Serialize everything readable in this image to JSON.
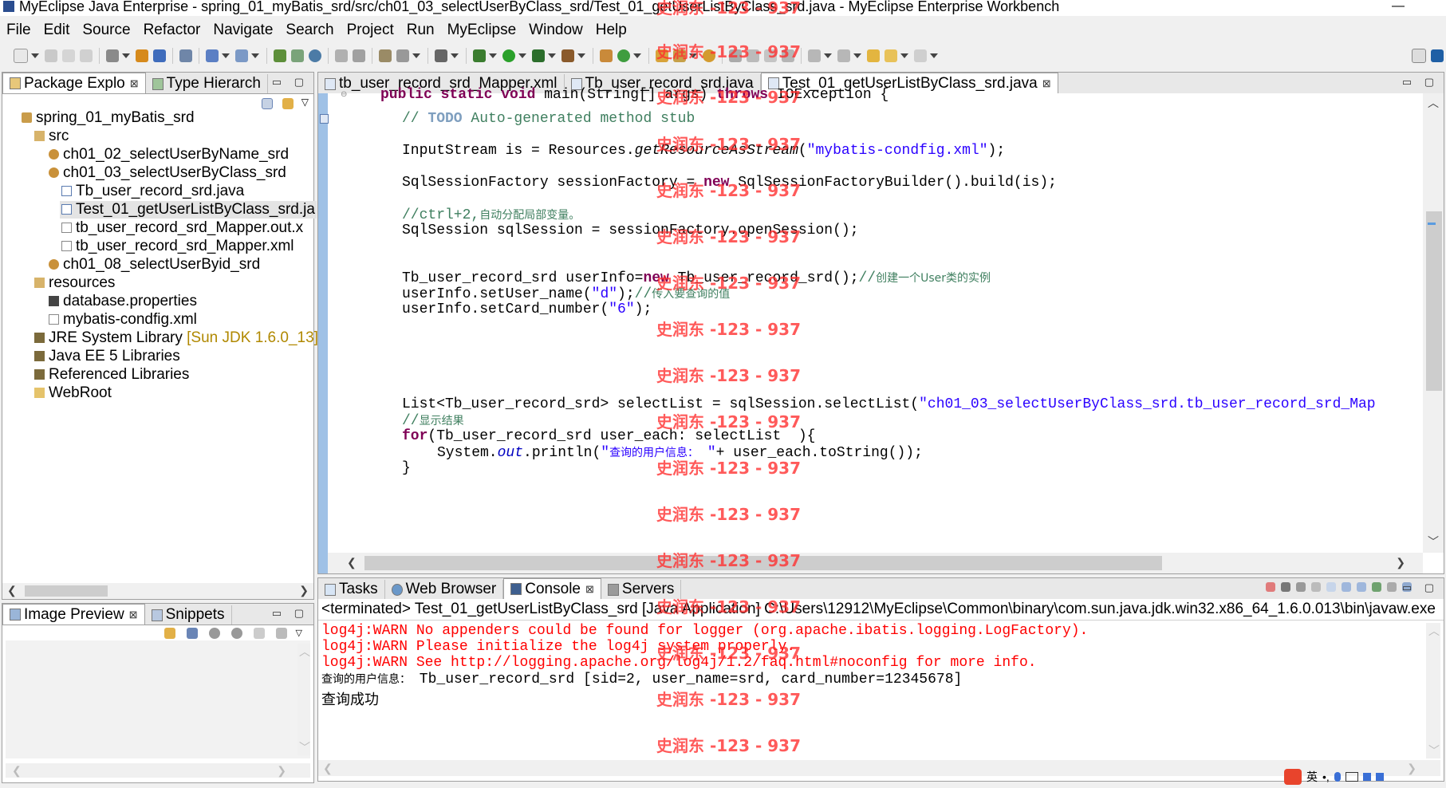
{
  "window": {
    "title": "MyEclipse Java Enterprise - spring_01_myBatis_srd/src/ch01_03_selectUserByClass_srd/Test_01_getUserListByClass_srd.java - MyEclipse Enterprise Workbench",
    "minimize": "—"
  },
  "menu": [
    "File",
    "Edit",
    "Source",
    "Refactor",
    "Navigate",
    "Search",
    "Project",
    "Run",
    "MyEclipse",
    "Window",
    "Help"
  ],
  "package_explorer": {
    "tabs": [
      {
        "label": "Package Explo",
        "close": "⊠"
      },
      {
        "label": "Type Hierarch"
      }
    ],
    "tree": [
      {
        "label": "spring_01_myBatis_srd",
        "icon": "project-icon"
      },
      {
        "label": "src",
        "icon": "source-folder-icon"
      },
      {
        "label": "ch01_02_selectUserByName_srd",
        "icon": "package-icon"
      },
      {
        "label": "ch01_03_selectUserByClass_srd",
        "icon": "package-icon"
      },
      {
        "label": "Tb_user_record_srd.java",
        "icon": "java-file-icon"
      },
      {
        "label": "Test_01_getUserListByClass_srd.ja",
        "icon": "java-file-icon"
      },
      {
        "label": "tb_user_record_srd_Mapper.out.x",
        "icon": "xml-file-icon"
      },
      {
        "label": "tb_user_record_srd_Mapper.xml",
        "icon": "xml-file-icon"
      },
      {
        "label": "ch01_08_selectUserByid_srd",
        "icon": "package-icon"
      },
      {
        "label": "resources",
        "icon": "source-folder-icon"
      },
      {
        "label": "database.properties",
        "icon": "properties-file-icon"
      },
      {
        "label": "mybatis-condfig.xml",
        "icon": "xml-file-icon"
      },
      {
        "label": "JRE System Library",
        "suffix": "[Sun JDK 1.6.0_13]",
        "icon": "library-icon"
      },
      {
        "label": "Java EE 5 Libraries",
        "icon": "library-icon"
      },
      {
        "label": "Referenced Libraries",
        "icon": "library-icon"
      },
      {
        "label": "WebRoot",
        "icon": "folder-icon"
      }
    ]
  },
  "image_preview": {
    "tabs": [
      {
        "label": "Image Preview",
        "close": "⊠"
      },
      {
        "label": "Snippets"
      }
    ]
  },
  "editor": {
    "tabs": [
      {
        "label": "tb_user_record_srd_Mapper.xml"
      },
      {
        "label": "Tb_user_record_srd.java"
      },
      {
        "label": "Test_01_getUserListByClass_srd.java",
        "close": "⊠"
      }
    ],
    "code": {
      "l1_a": "public static void",
      "l1_b": " main(String[] args) ",
      "l1_c": "throws",
      "l1_d": " IOException {",
      "l2_a": "// ",
      "l2_b": "TODO",
      "l2_c": " Auto-generated method stub",
      "l3_a": "InputStream is = Resources.",
      "l3_b": "getResourceAsStream",
      "l3_c": "(",
      "l3_d": "\"mybatis-condfig.xml\"",
      "l3_e": ");",
      "l4_a": "SqlSessionFactory sessionFactory = ",
      "l4_b": "new",
      "l4_c": " SqlSessionFactoryBuilder().build(is);",
      "l5_a": "//ctrl+2,",
      "l5_b": "自动分配局部变量。",
      "l6": "SqlSession sqlSession = sessionFactory.openSession();",
      "l7_a": "Tb_user_record_srd userInfo=",
      "l7_b": "new",
      "l7_c": " Tb_user_record_srd();",
      "l7_d": "//",
      "l7_e": "创建一个User类的实例",
      "l8_a": "userInfo.setUser_name(",
      "l8_b": "\"d\"",
      "l8_c": ");",
      "l8_d": "//",
      "l8_e": "传入要查询的值",
      "l9_a": "userInfo.setCard_number(",
      "l9_b": "\"6\"",
      "l9_c": ");",
      "l10_a": "List<Tb_user_record_srd> selectList = sqlSession.selectList(",
      "l10_b": "\"ch01_03_selectUserByClass_srd.tb_user_record_srd_Map",
      "l11_a": "//",
      "l11_b": "显示结果",
      "l12_a": "for",
      "l12_b": "(Tb_user_record_srd user_each: selectList  ){",
      "l13_a": "System.",
      "l13_b": "out",
      "l13_c": ".println(",
      "l13_d": "\"",
      "l13_e": "查询的用户信息：",
      "l13_f": " \"",
      "l13_g": "+ user_each.toString());",
      "l14": "}"
    }
  },
  "console": {
    "tabs": [
      {
        "label": "Tasks"
      },
      {
        "label": "Web Browser"
      },
      {
        "label": "Console",
        "close": "⊠"
      },
      {
        "label": "Servers"
      }
    ],
    "header": "<terminated> Test_01_getUserListByClass_srd [Java Application] C:\\Users\\12912\\MyEclipse\\Common\\binary\\com.sun.java.jdk.win32.x86_64_1.6.0.013\\bin\\javaw.exe",
    "lines": [
      {
        "text": "log4j:WARN No appenders could be found for logger (org.apache.ibatis.logging.LogFactory).",
        "kind": "error"
      },
      {
        "text": "log4j:WARN Please initialize the log4j system properly.",
        "kind": "error"
      },
      {
        "text": "log4j:WARN See http://logging.apache.org/log4j/1.2/faq.html#noconfig for more info.",
        "kind": "error"
      },
      {
        "text_a": "查询的用户信息：",
        "text_b": " Tb_user_record_srd [sid=2, user_name=srd, card_number=12345678]",
        "kind": "output"
      },
      {
        "text": "查询成功",
        "kind": "output"
      }
    ]
  },
  "watermark": {
    "text": "史润东 -123 - 937",
    "color": "#ff2d2d"
  },
  "taskbar": {
    "ime": "英"
  }
}
